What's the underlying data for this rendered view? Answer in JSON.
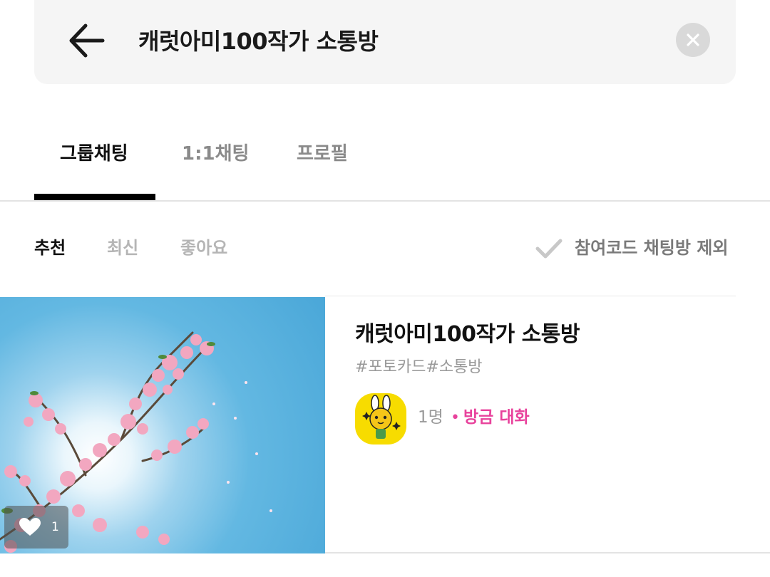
{
  "search": {
    "query": "캐럿아미100작가 소통방"
  },
  "tabs": [
    {
      "label": "그룹채팅",
      "active": true
    },
    {
      "label": "1:1채팅",
      "active": false
    },
    {
      "label": "프로필",
      "active": false
    }
  ],
  "sort": {
    "options": [
      "추천",
      "최신",
      "좋아요"
    ],
    "selected": "추천",
    "exclude_label": "참여코드 채팅방 제외"
  },
  "results": [
    {
      "title": "캐럿아미100작가 소통방",
      "tags": "#포토카드#소통방",
      "members": "1명",
      "separator": "•",
      "activity": "방금 대화",
      "likes": "1"
    }
  ],
  "colors": {
    "accent": "#e8429c",
    "search_bg": "#f5f5f5",
    "avatar_bg": "#f7dc00",
    "sky": "#4aa7d8",
    "blossom": "#f2a7c0"
  },
  "icons": {
    "back": "arrow-left",
    "clear": "close-circle",
    "exclude": "check",
    "like": "heart"
  }
}
